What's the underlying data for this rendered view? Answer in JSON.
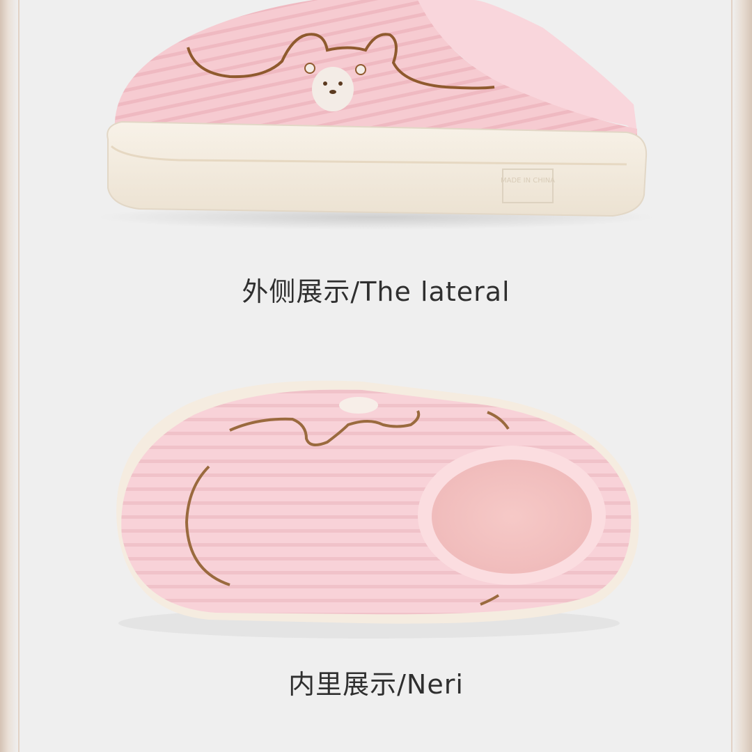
{
  "colors": {
    "background": "#efefef",
    "border": "#d4c2b4",
    "slipper_pink": "#f7cfd4",
    "sole_cream": "#f3ebdd",
    "embroidery_brown": "#9a6a3e",
    "caption_text": "#2f2f2f"
  },
  "sections": [
    {
      "image": "slipper-side-view",
      "sole_label": "MADE IN CHINA",
      "caption": "外侧展示/The lateral"
    },
    {
      "image": "slipper-top-view",
      "caption": "内里展示/Neri"
    }
  ]
}
